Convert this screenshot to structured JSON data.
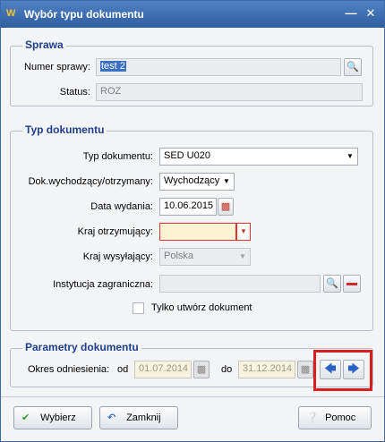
{
  "window": {
    "title": "Wybór typu dokumentu",
    "logo": "W"
  },
  "sprawa": {
    "title": "Sprawa",
    "numer_label": "Numer sprawy:",
    "numer_value": "test 2",
    "status_label": "Status:",
    "status_value": "ROZ"
  },
  "typ": {
    "title": "Typ dokumentu",
    "typ_label": "Typ dokumentu:",
    "typ_value": "SED U020",
    "dok_label": "Dok.wychodzący/otrzymany:",
    "dok_value": "Wychodzący",
    "data_label": "Data wydania:",
    "data_value": "10.06.2015",
    "kraj_otrz_label": "Kraj otrzymujący:",
    "kraj_otrz_value": "",
    "kraj_wys_label": "Kraj wysyłający:",
    "kraj_wys_value": "Polska",
    "inst_label": "Instytucja zagraniczna:",
    "inst_value": "",
    "tylko_label": "Tylko utwórz dokument"
  },
  "parametry": {
    "title": "Parametry dokumentu",
    "okres_label": "Okres odniesienia:",
    "od_label": "od",
    "od_value": "01.07.2014",
    "do_label": "do",
    "do_value": "31.12.2014"
  },
  "buttons": {
    "wybierz": "Wybierz",
    "zamknij": "Zamknij",
    "pomoc": "Pomoc"
  },
  "colors": {
    "accent": "#2f5e9e",
    "highlight": "#d91e1e"
  }
}
